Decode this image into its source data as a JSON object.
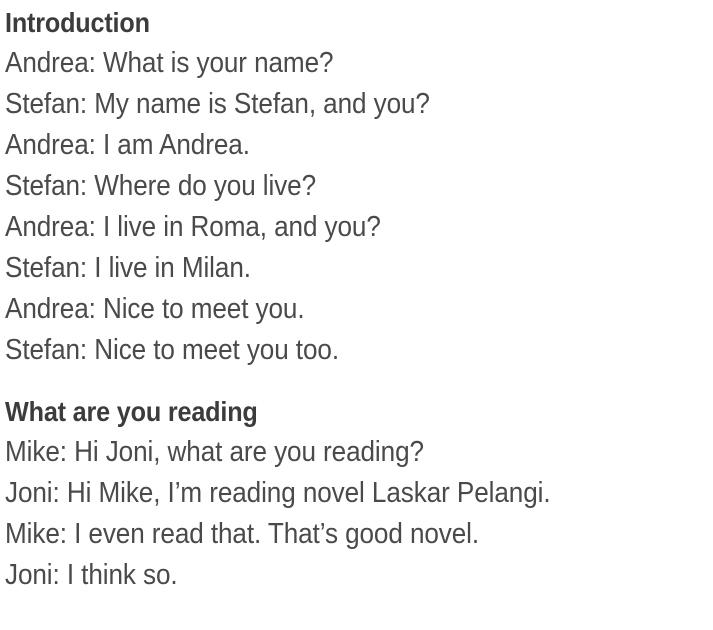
{
  "document": {
    "background_color": "#ffffff",
    "text_color": "#4a4a4a",
    "heading_color": "#3c3c3c",
    "sections": [
      {
        "heading": "Introduction",
        "lines": [
          "Andrea: What is your name?",
          "Stefan: My name is Stefan, and you?",
          "Andrea: I am Andrea.",
          "Stefan: Where do you live?",
          "Andrea: I live in Roma, and you?",
          "Stefan: I live in Milan.",
          "Andrea: Nice to meet you.",
          "Stefan: Nice to meet you too."
        ]
      },
      {
        "heading": "What are you reading",
        "lines": [
          "Mike: Hi Joni, what are you reading?",
          "Joni: Hi Mike, I’m reading novel Laskar Pelangi.",
          "Mike: I even read that. That’s good novel.",
          "Joni: I think so."
        ]
      }
    ]
  }
}
